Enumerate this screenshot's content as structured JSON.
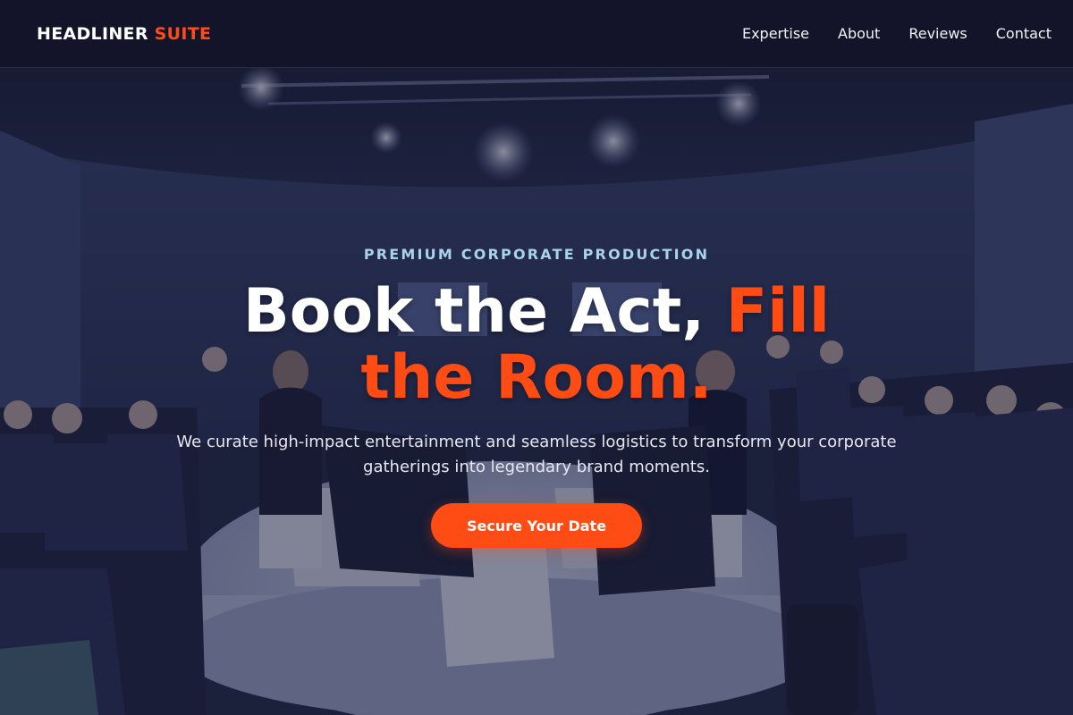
{
  "navbar": {
    "logo_main": "HEADLINER",
    "logo_accent": "SUITE",
    "links": [
      "Expertise",
      "About",
      "Reviews",
      "Contact"
    ]
  },
  "hero": {
    "eyebrow": "PREMIUM CORPORATE PRODUCTION",
    "headline_main": "Book the Act, ",
    "headline_accent": "Fill the Room.",
    "subtext": "We curate high-impact entertainment and seamless logistics to transform your corporate gatherings into legendary brand moments.",
    "cta_label": "Secure Your Date",
    "background_description_icon": "conference-panel-photo"
  },
  "colors": {
    "nav_bg": "#13142a",
    "accent": "#ff4b14",
    "eyebrow": "#a9d2ec",
    "text_light": "#ffffff"
  }
}
